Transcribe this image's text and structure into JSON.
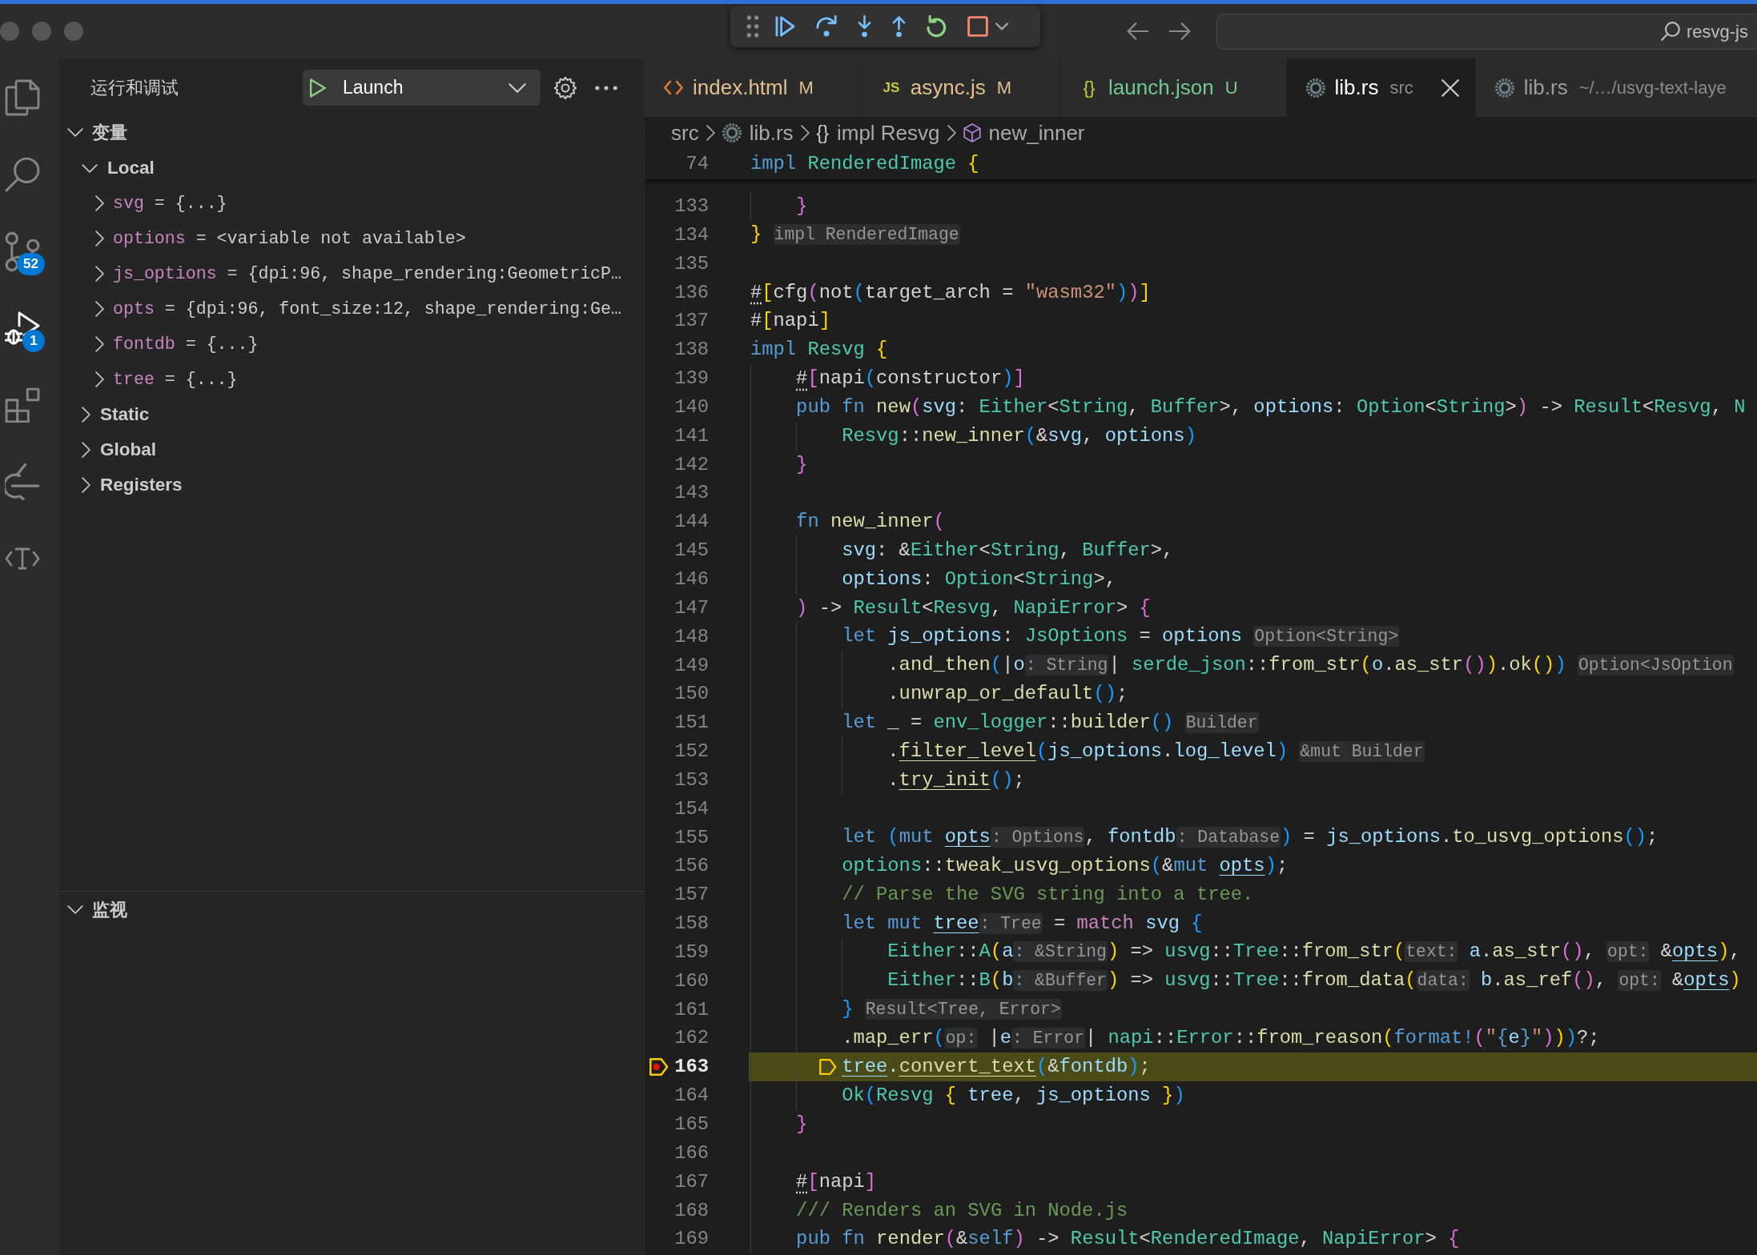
{
  "title_bar": {
    "command_center": "resvg-js"
  },
  "activity_bar": [
    {
      "selected": false
    },
    {
      "selected": false
    },
    {
      "selected": false,
      "badge": "52"
    },
    {
      "selected": true,
      "badge": "1"
    },
    {
      "selected": false
    },
    {
      "selected": false
    },
    {
      "selected": false
    }
  ],
  "sidebar": {
    "title": "运行和调试",
    "launch_config": "Launch",
    "sections": [
      {
        "title": "变量",
        "expanded": true,
        "children": [
          {
            "label": "Local",
            "expanded": true,
            "children": [
              {
                "name": "svg",
                "sep": "=",
                "value": "{...}",
                "expanded": false
              },
              {
                "name": "options",
                "sep": "=",
                "value": "<variable not available>",
                "expanded": false
              },
              {
                "name": "js_options",
                "sep": "=",
                "value": "{dpi:96, shape_rendering:GeometricP…",
                "expanded": false
              },
              {
                "name": "opts",
                "sep": "=",
                "value": "{dpi:96, font_size:12, shape_rendering:Ge…",
                "expanded": false
              },
              {
                "name": "fontdb",
                "sep": "=",
                "value": "{...}",
                "expanded": false
              },
              {
                "name": "tree",
                "sep": "=",
                "value": "{...}",
                "expanded": false
              }
            ]
          },
          {
            "label": "Static",
            "expanded": false
          },
          {
            "label": "Global",
            "expanded": false
          },
          {
            "label": "Registers",
            "expanded": false
          }
        ]
      },
      {
        "title": "监视",
        "expanded": true
      }
    ]
  },
  "tabs": [
    {
      "kind": "html",
      "label": "index.html",
      "decoration": "M",
      "modified": true,
      "untracked": false,
      "selected": false
    },
    {
      "kind": "js",
      "icon_text": "JS",
      "label": "async.js",
      "decoration": "M",
      "modified": true,
      "untracked": false,
      "selected": false
    },
    {
      "kind": "json",
      "icon_text": "{}",
      "label": "launch.json",
      "decoration": "U",
      "modified": false,
      "untracked": true,
      "selected": false
    },
    {
      "kind": "rust",
      "label": "lib.rs",
      "decoration": "src",
      "modified": false,
      "untracked": false,
      "selected": true
    },
    {
      "kind": "rust",
      "label": "lib.rs",
      "decoration": "~/…/usvg-text-laye",
      "modified": false,
      "untracked": false,
      "selected": false
    }
  ],
  "breadcrumbs": [
    {
      "kind": "folder",
      "label": "src"
    },
    {
      "kind": "file",
      "label": "lib.rs"
    },
    {
      "kind": "impl",
      "symbol": "{}",
      "label": "impl Resvg"
    },
    {
      "kind": "method",
      "label": "new_inner"
    }
  ],
  "editor": {
    "sticky": {
      "n": "74",
      "tokens": [
        {
          "text": "impl ",
          "kind": "keyword"
        },
        {
          "text": "RenderedImage ",
          "kind": "type"
        },
        {
          "text": "{",
          "kind": "bracket1"
        }
      ]
    },
    "lines": [
      {
        "n": "133",
        "current": false,
        "breakpoint": false,
        "tokens": [
          {
            "text": "    }",
            "kind": "bracket2"
          }
        ]
      },
      {
        "n": "134",
        "current": false,
        "breakpoint": false,
        "tokens": [
          {
            "text": "} ",
            "kind": "bracket1"
          },
          {
            "text": "impl RenderedImage",
            "kind": "hint"
          }
        ]
      },
      {
        "n": "135",
        "current": false,
        "breakpoint": false
      },
      {
        "n": "136",
        "current": false,
        "breakpoint": false,
        "tokens": [
          {
            "text": "#",
            "kind": "attribute"
          },
          {
            "text": "[",
            "kind": "bracket1"
          },
          {
            "text": "cfg",
            "kind": "plain"
          },
          {
            "text": "(",
            "kind": "bracket2"
          },
          {
            "text": "not",
            "kind": "plain"
          },
          {
            "text": "(",
            "kind": "bracket3"
          },
          {
            "text": "target_arch = ",
            "kind": "plain"
          },
          {
            "text": "\"wasm32\"",
            "kind": "string"
          },
          {
            "text": ")",
            "kind": "bracket3"
          },
          {
            "text": ")",
            "kind": "bracket2"
          },
          {
            "text": "]",
            "kind": "bracket1"
          }
        ]
      },
      {
        "n": "137",
        "current": false,
        "breakpoint": false,
        "tokens": [
          {
            "text": "#",
            "kind": "plain"
          },
          {
            "text": "[",
            "kind": "bracket1"
          },
          {
            "text": "napi",
            "kind": "plain"
          },
          {
            "text": "]",
            "kind": "bracket1"
          }
        ]
      },
      {
        "n": "138",
        "current": false,
        "breakpoint": false,
        "tokens": [
          {
            "text": "impl ",
            "kind": "keyword"
          },
          {
            "text": "Resvg ",
            "kind": "type"
          },
          {
            "text": "{",
            "kind": "bracket1"
          }
        ]
      },
      {
        "n": "139",
        "current": false,
        "breakpoint": false,
        "tokens": [
          {
            "text": "    #",
            "kind": "attribute"
          },
          {
            "text": "[",
            "kind": "bracket2"
          },
          {
            "text": "napi",
            "kind": "plain"
          },
          {
            "text": "(",
            "kind": "bracket3"
          },
          {
            "text": "constructor",
            "kind": "plain"
          },
          {
            "text": ")",
            "kind": "bracket3"
          },
          {
            "text": "]",
            "kind": "bracket2"
          }
        ]
      },
      {
        "n": "140",
        "current": false,
        "breakpoint": false,
        "tokens": [
          {
            "text": "    pub fn ",
            "kind": "keyword"
          },
          {
            "text": "new",
            "kind": "function"
          },
          {
            "text": "(",
            "kind": "bracket2"
          },
          {
            "text": "svg",
            "kind": "variable"
          },
          {
            "text": ": ",
            "kind": "plain"
          },
          {
            "text": "Either",
            "kind": "type"
          },
          {
            "text": "<",
            "kind": "plain"
          },
          {
            "text": "String",
            "kind": "type"
          },
          {
            "text": ", ",
            "kind": "plain"
          },
          {
            "text": "Buffer",
            "kind": "type"
          },
          {
            "text": ">, ",
            "kind": "plain"
          },
          {
            "text": "options",
            "kind": "variable"
          },
          {
            "text": ": ",
            "kind": "plain"
          },
          {
            "text": "Option",
            "kind": "type"
          },
          {
            "text": "<",
            "kind": "plain"
          },
          {
            "text": "String",
            "kind": "type"
          },
          {
            "text": ">",
            "kind": "plain"
          },
          {
            "text": ")",
            "kind": "bracket2"
          },
          {
            "text": " -> ",
            "kind": "plain"
          },
          {
            "text": "Result",
            "kind": "type"
          },
          {
            "text": "<",
            "kind": "plain"
          },
          {
            "text": "Resvg",
            "kind": "type"
          },
          {
            "text": ", ",
            "kind": "plain"
          },
          {
            "text": "N",
            "kind": "type"
          }
        ]
      },
      {
        "n": "141",
        "current": false,
        "breakpoint": false,
        "tokens": [
          {
            "text": "        Resvg",
            "kind": "type"
          },
          {
            "text": "::",
            "kind": "plain"
          },
          {
            "text": "new_inner",
            "kind": "function"
          },
          {
            "text": "(",
            "kind": "bracket3"
          },
          {
            "text": "&",
            "kind": "plain"
          },
          {
            "text": "svg",
            "kind": "variable"
          },
          {
            "text": ", ",
            "kind": "plain"
          },
          {
            "text": "options",
            "kind": "variable"
          },
          {
            "text": ")",
            "kind": "bracket3"
          }
        ]
      },
      {
        "n": "142",
        "current": false,
        "breakpoint": false,
        "tokens": [
          {
            "text": "    }",
            "kind": "bracket2"
          }
        ]
      },
      {
        "n": "143",
        "current": false,
        "breakpoint": false
      },
      {
        "n": "144",
        "current": false,
        "breakpoint": false,
        "tokens": [
          {
            "text": "    fn ",
            "kind": "keyword"
          },
          {
            "text": "new_inner",
            "kind": "function"
          },
          {
            "text": "(",
            "kind": "bracket2"
          }
        ]
      },
      {
        "n": "145",
        "current": false,
        "breakpoint": false,
        "tokens": [
          {
            "text": "        svg",
            "kind": "variable"
          },
          {
            "text": ": &",
            "kind": "plain"
          },
          {
            "text": "Either",
            "kind": "type"
          },
          {
            "text": "<",
            "kind": "plain"
          },
          {
            "text": "String",
            "kind": "type"
          },
          {
            "text": ", ",
            "kind": "plain"
          },
          {
            "text": "Buffer",
            "kind": "type"
          },
          {
            "text": ">,",
            "kind": "plain"
          }
        ]
      },
      {
        "n": "146",
        "current": false,
        "breakpoint": false,
        "tokens": [
          {
            "text": "        options",
            "kind": "variable"
          },
          {
            "text": ": ",
            "kind": "plain"
          },
          {
            "text": "Option",
            "kind": "type"
          },
          {
            "text": "<",
            "kind": "plain"
          },
          {
            "text": "String",
            "kind": "type"
          },
          {
            "text": ">,",
            "kind": "plain"
          }
        ]
      },
      {
        "n": "147",
        "current": false,
        "breakpoint": false,
        "tokens": [
          {
            "text": "    )",
            "kind": "bracket2"
          },
          {
            "text": " -> ",
            "kind": "plain"
          },
          {
            "text": "Result",
            "kind": "type"
          },
          {
            "text": "<",
            "kind": "plain"
          },
          {
            "text": "Resvg",
            "kind": "type"
          },
          {
            "text": ", ",
            "kind": "plain"
          },
          {
            "text": "NapiError",
            "kind": "type"
          },
          {
            "text": "> ",
            "kind": "plain"
          },
          {
            "text": "{",
            "kind": "bracket2"
          }
        ]
      },
      {
        "n": "148",
        "current": false,
        "breakpoint": false,
        "tokens": [
          {
            "text": "        let ",
            "kind": "keyword"
          },
          {
            "text": "js_options",
            "kind": "variable"
          },
          {
            "text": ": ",
            "kind": "plain"
          },
          {
            "text": "JsOptions",
            "kind": "type"
          },
          {
            "text": " = ",
            "kind": "plain"
          },
          {
            "text": "options ",
            "kind": "variable"
          },
          {
            "text": "Option<String>",
            "kind": "hint"
          }
        ]
      },
      {
        "n": "149",
        "current": false,
        "breakpoint": false,
        "tokens": [
          {
            "text": "            .",
            "kind": "plain"
          },
          {
            "text": "and_then",
            "kind": "function"
          },
          {
            "text": "(",
            "kind": "bracket3"
          },
          {
            "text": "|",
            "kind": "plain"
          },
          {
            "text": "o",
            "kind": "variable"
          },
          {
            "text": ": String",
            "kind": "hint"
          },
          {
            "text": "| ",
            "kind": "plain"
          },
          {
            "text": "serde_json",
            "kind": "type"
          },
          {
            "text": "::",
            "kind": "plain"
          },
          {
            "text": "from_str",
            "kind": "function"
          },
          {
            "text": "(",
            "kind": "bracket1"
          },
          {
            "text": "o",
            "kind": "variable"
          },
          {
            "text": ".",
            "kind": "plain"
          },
          {
            "text": "as_str",
            "kind": "function"
          },
          {
            "text": "()",
            "kind": "bracket2"
          },
          {
            "text": ")",
            "kind": "bracket1"
          },
          {
            "text": ".",
            "kind": "plain"
          },
          {
            "text": "ok",
            "kind": "function"
          },
          {
            "text": "()",
            "kind": "bracket1"
          },
          {
            "text": ") ",
            "kind": "bracket3"
          },
          {
            "text": "Option<JsOption",
            "kind": "hint"
          }
        ]
      },
      {
        "n": "150",
        "current": false,
        "breakpoint": false,
        "tokens": [
          {
            "text": "            .",
            "kind": "plain"
          },
          {
            "text": "unwrap_or_default",
            "kind": "function"
          },
          {
            "text": "()",
            "kind": "bracket3"
          },
          {
            "text": ";",
            "kind": "plain"
          }
        ]
      },
      {
        "n": "151",
        "current": false,
        "breakpoint": false,
        "tokens": [
          {
            "text": "        let ",
            "kind": "keyword"
          },
          {
            "text": "_ = ",
            "kind": "plain"
          },
          {
            "text": "env_logger",
            "kind": "type"
          },
          {
            "text": "::",
            "kind": "plain"
          },
          {
            "text": "builder",
            "kind": "function"
          },
          {
            "text": "() ",
            "kind": "bracket3"
          },
          {
            "text": "Builder",
            "kind": "hint"
          }
        ]
      },
      {
        "n": "152",
        "current": false,
        "breakpoint": false,
        "tokens": [
          {
            "text": "            .",
            "kind": "plain"
          },
          {
            "text": "filter_level",
            "kind": "mutfunction"
          },
          {
            "text": "(",
            "kind": "bracket3"
          },
          {
            "text": "js_options",
            "kind": "variable"
          },
          {
            "text": ".",
            "kind": "plain"
          },
          {
            "text": "log_level",
            "kind": "variable"
          },
          {
            "text": ") ",
            "kind": "bracket3"
          },
          {
            "text": "&mut Builder",
            "kind": "hint"
          }
        ]
      },
      {
        "n": "153",
        "current": false,
        "breakpoint": false,
        "tokens": [
          {
            "text": "            .",
            "kind": "plain"
          },
          {
            "text": "try_init",
            "kind": "mutfunction"
          },
          {
            "text": "()",
            "kind": "bracket3"
          },
          {
            "text": ";",
            "kind": "plain"
          }
        ]
      },
      {
        "n": "154",
        "current": false,
        "breakpoint": false
      },
      {
        "n": "155",
        "current": false,
        "breakpoint": false,
        "tokens": [
          {
            "text": "        let ",
            "kind": "keyword"
          },
          {
            "text": "(",
            "kind": "bracket3"
          },
          {
            "text": "mut ",
            "kind": "keyword"
          },
          {
            "text": "opts",
            "kind": "mutvariable"
          },
          {
            "text": ": Options",
            "kind": "hint"
          },
          {
            "text": ", ",
            "kind": "plain"
          },
          {
            "text": "fontdb",
            "kind": "variable"
          },
          {
            "text": ": Database",
            "kind": "hint"
          },
          {
            "text": ")",
            "kind": "bracket3"
          },
          {
            "text": " = ",
            "kind": "plain"
          },
          {
            "text": "js_options",
            "kind": "variable"
          },
          {
            "text": ".",
            "kind": "plain"
          },
          {
            "text": "to_usvg_options",
            "kind": "function"
          },
          {
            "text": "()",
            "kind": "bracket3"
          },
          {
            "text": ";",
            "kind": "plain"
          }
        ]
      },
      {
        "n": "156",
        "current": false,
        "breakpoint": false,
        "tokens": [
          {
            "text": "        options",
            "kind": "type"
          },
          {
            "text": "::",
            "kind": "plain"
          },
          {
            "text": "tweak_usvg_options",
            "kind": "function"
          },
          {
            "text": "(",
            "kind": "bracket3"
          },
          {
            "text": "&",
            "kind": "plain"
          },
          {
            "text": "mut ",
            "kind": "keyword"
          },
          {
            "text": "opts",
            "kind": "mutvariable"
          },
          {
            "text": ")",
            "kind": "bracket3"
          },
          {
            "text": ";",
            "kind": "plain"
          }
        ]
      },
      {
        "n": "157",
        "current": false,
        "breakpoint": false,
        "tokens": [
          {
            "text": "        // Parse the SVG string into a tree.",
            "kind": "comment"
          }
        ]
      },
      {
        "n": "158",
        "current": false,
        "breakpoint": false,
        "tokens": [
          {
            "text": "        let mut ",
            "kind": "keyword"
          },
          {
            "text": "tree",
            "kind": "mutvariable"
          },
          {
            "text": ": Tree",
            "kind": "hint"
          },
          {
            "text": " = ",
            "kind": "plain"
          },
          {
            "text": "match ",
            "kind": "control"
          },
          {
            "text": "svg ",
            "kind": "variable"
          },
          {
            "text": "{",
            "kind": "bracket3"
          }
        ]
      },
      {
        "n": "159",
        "current": false,
        "breakpoint": false,
        "tokens": [
          {
            "text": "            Either",
            "kind": "type"
          },
          {
            "text": "::",
            "kind": "plain"
          },
          {
            "text": "A",
            "kind": "type"
          },
          {
            "text": "(",
            "kind": "bracket1"
          },
          {
            "text": "a",
            "kind": "variable"
          },
          {
            "text": ": &String",
            "kind": "hint"
          },
          {
            "text": ")",
            "kind": "bracket1"
          },
          {
            "text": " => ",
            "kind": "plain"
          },
          {
            "text": "usvg",
            "kind": "type"
          },
          {
            "text": "::",
            "kind": "plain"
          },
          {
            "text": "Tree",
            "kind": "type"
          },
          {
            "text": "::",
            "kind": "plain"
          },
          {
            "text": "from_str",
            "kind": "function"
          },
          {
            "text": "(",
            "kind": "bracket1"
          },
          {
            "text": "text:",
            "kind": "hint"
          },
          {
            "text": " a",
            "kind": "variable"
          },
          {
            "text": ".",
            "kind": "plain"
          },
          {
            "text": "as_str",
            "kind": "function"
          },
          {
            "text": "()",
            "kind": "bracket2"
          },
          {
            "text": ", ",
            "kind": "plain"
          },
          {
            "text": "opt:",
            "kind": "hint"
          },
          {
            "text": " &",
            "kind": "plain"
          },
          {
            "text": "opts",
            "kind": "mutvariable"
          },
          {
            "text": ")",
            "kind": "bracket1"
          },
          {
            "text": ",",
            "kind": "plain"
          }
        ]
      },
      {
        "n": "160",
        "current": false,
        "breakpoint": false,
        "tokens": [
          {
            "text": "            Either",
            "kind": "type"
          },
          {
            "text": "::",
            "kind": "plain"
          },
          {
            "text": "B",
            "kind": "type"
          },
          {
            "text": "(",
            "kind": "bracket1"
          },
          {
            "text": "b",
            "kind": "variable"
          },
          {
            "text": ": &Buffer",
            "kind": "hint"
          },
          {
            "text": ")",
            "kind": "bracket1"
          },
          {
            "text": " => ",
            "kind": "plain"
          },
          {
            "text": "usvg",
            "kind": "type"
          },
          {
            "text": "::",
            "kind": "plain"
          },
          {
            "text": "Tree",
            "kind": "type"
          },
          {
            "text": "::",
            "kind": "plain"
          },
          {
            "text": "from_data",
            "kind": "function"
          },
          {
            "text": "(",
            "kind": "bracket1"
          },
          {
            "text": "data:",
            "kind": "hint"
          },
          {
            "text": " b",
            "kind": "variable"
          },
          {
            "text": ".",
            "kind": "plain"
          },
          {
            "text": "as_ref",
            "kind": "function"
          },
          {
            "text": "()",
            "kind": "bracket2"
          },
          {
            "text": ", ",
            "kind": "plain"
          },
          {
            "text": "opt:",
            "kind": "hint"
          },
          {
            "text": " &",
            "kind": "plain"
          },
          {
            "text": "opts",
            "kind": "mutvariable"
          },
          {
            "text": ")",
            "kind": "bracket1"
          }
        ]
      },
      {
        "n": "161",
        "current": false,
        "breakpoint": false,
        "tokens": [
          {
            "text": "        } ",
            "kind": "bracket3"
          },
          {
            "text": "Result<Tree, Error>",
            "kind": "hint"
          }
        ]
      },
      {
        "n": "162",
        "current": false,
        "breakpoint": false,
        "tokens": [
          {
            "text": "        .",
            "kind": "plain"
          },
          {
            "text": "map_err",
            "kind": "function"
          },
          {
            "text": "(",
            "kind": "bracket3"
          },
          {
            "text": "op:",
            "kind": "hint"
          },
          {
            "text": " |",
            "kind": "plain"
          },
          {
            "text": "e",
            "kind": "variable"
          },
          {
            "text": ": Error",
            "kind": "hint"
          },
          {
            "text": "| ",
            "kind": "plain"
          },
          {
            "text": "napi",
            "kind": "type"
          },
          {
            "text": "::",
            "kind": "plain"
          },
          {
            "text": "Error",
            "kind": "type"
          },
          {
            "text": "::",
            "kind": "plain"
          },
          {
            "text": "from_reason",
            "kind": "function"
          },
          {
            "text": "(",
            "kind": "bracket1"
          },
          {
            "text": "format!",
            "kind": "keyword"
          },
          {
            "text": "(",
            "kind": "bracket2"
          },
          {
            "text": "\"",
            "kind": "string"
          },
          {
            "text": "{",
            "kind": "keyword"
          },
          {
            "text": "e",
            "kind": "variable"
          },
          {
            "text": "}",
            "kind": "keyword"
          },
          {
            "text": "\"",
            "kind": "string"
          },
          {
            "text": ")",
            "kind": "bracket2"
          },
          {
            "text": ")",
            "kind": "bracket1"
          },
          {
            "text": ")",
            "kind": "bracket3"
          },
          {
            "text": "?;",
            "kind": "plain"
          }
        ]
      },
      {
        "n": "163",
        "current": true,
        "breakpoint": true,
        "tokens": [
          {
            "text": "        tree",
            "kind": "mutvariable"
          },
          {
            "text": ".",
            "kind": "plain"
          },
          {
            "text": "convert_text",
            "kind": "mutfunction"
          },
          {
            "text": "(",
            "kind": "bracket3"
          },
          {
            "text": "&",
            "kind": "plain"
          },
          {
            "text": "fontdb",
            "kind": "variable"
          },
          {
            "text": ")",
            "kind": "bracket3"
          },
          {
            "text": ";",
            "kind": "plain"
          }
        ]
      },
      {
        "n": "164",
        "current": false,
        "breakpoint": false,
        "tokens": [
          {
            "text": "        Ok",
            "kind": "type"
          },
          {
            "text": "(",
            "kind": "bracket3"
          },
          {
            "text": "Resvg ",
            "kind": "type"
          },
          {
            "text": "{ ",
            "kind": "bracket1"
          },
          {
            "text": "tree",
            "kind": "variable"
          },
          {
            "text": ", ",
            "kind": "plain"
          },
          {
            "text": "js_options ",
            "kind": "variable"
          },
          {
            "text": "}",
            "kind": "bracket1"
          },
          {
            "text": ")",
            "kind": "bracket3"
          }
        ]
      },
      {
        "n": "165",
        "current": false,
        "breakpoint": false,
        "tokens": [
          {
            "text": "    }",
            "kind": "bracket2"
          }
        ]
      },
      {
        "n": "166",
        "current": false,
        "breakpoint": false
      },
      {
        "n": "167",
        "current": false,
        "breakpoint": false,
        "tokens": [
          {
            "text": "    #",
            "kind": "attribute"
          },
          {
            "text": "[",
            "kind": "bracket2"
          },
          {
            "text": "napi",
            "kind": "plain"
          },
          {
            "text": "]",
            "kind": "bracket2"
          }
        ]
      },
      {
        "n": "168",
        "current": false,
        "breakpoint": false,
        "tokens": [
          {
            "text": "    /// Renders an SVG in Node.js",
            "kind": "comment"
          }
        ]
      },
      {
        "n": "169",
        "current": false,
        "breakpoint": false,
        "tokens": [
          {
            "text": "    pub fn ",
            "kind": "keyword"
          },
          {
            "text": "render",
            "kind": "function"
          },
          {
            "text": "(",
            "kind": "bracket2"
          },
          {
            "text": "&",
            "kind": "plain"
          },
          {
            "text": "self",
            "kind": "keyword"
          },
          {
            "text": ")",
            "kind": "bracket2"
          },
          {
            "text": " -> ",
            "kind": "plain"
          },
          {
            "text": "Result",
            "kind": "type"
          },
          {
            "text": "<",
            "kind": "plain"
          },
          {
            "text": "RenderedImage",
            "kind": "type"
          },
          {
            "text": ", ",
            "kind": "plain"
          },
          {
            "text": "NapiError",
            "kind": "type"
          },
          {
            "text": "> ",
            "kind": "plain"
          },
          {
            "text": "{",
            "kind": "bracket2"
          }
        ]
      }
    ]
  }
}
